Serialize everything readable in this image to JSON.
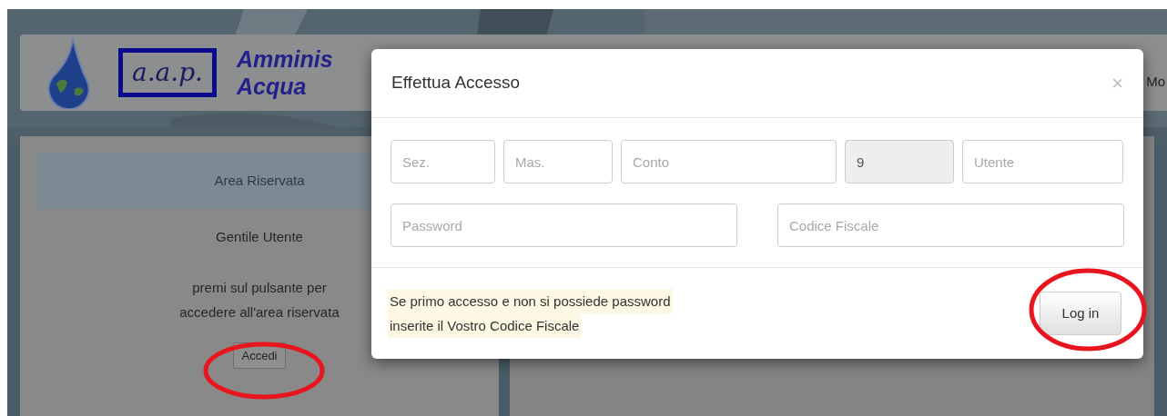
{
  "header": {
    "logo_text": "a.a.p.",
    "title_lines": [
      "Amminis",
      "Acqua"
    ],
    "nav_item": "Mo"
  },
  "sidebar": {
    "title": "Area Riservata",
    "greeting": "Gentile Utente",
    "message_lines": [
      "premi sul pulsante per",
      "accedere all'area riservata"
    ],
    "button": "Accedi"
  },
  "modal": {
    "title": "Effettua Accesso",
    "close": "×",
    "field_rows": [
      [
        {
          "placeholder": "Sez.",
          "disabled": false
        },
        {
          "placeholder": "Mas.",
          "disabled": false
        },
        {
          "placeholder": "Conto",
          "disabled": false
        },
        {
          "value": "9",
          "disabled": true
        },
        {
          "placeholder": "Utente",
          "disabled": false
        }
      ],
      [
        {
          "placeholder": "Password",
          "disabled": false
        },
        {
          "placeholder": "Codice Fiscale",
          "disabled": false
        }
      ]
    ],
    "note_lines": [
      "Se primo accesso e non si possiede password",
      "inserite il Vostro Codice Fiscale"
    ],
    "submit": "Log in"
  }
}
